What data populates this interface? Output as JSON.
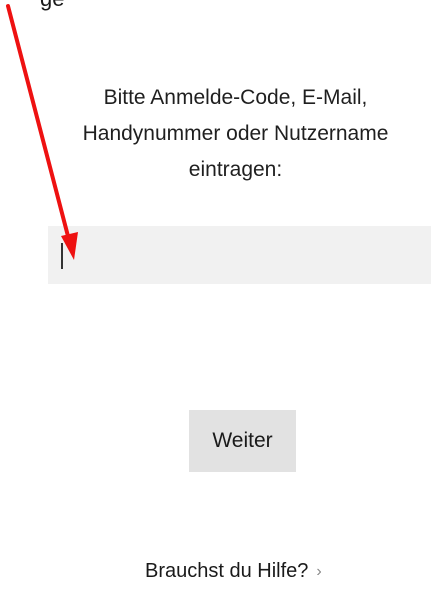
{
  "top_text": "ge",
  "prompt": {
    "line1": "Bitte Anmelde-Code, E-Mail,",
    "line2": "Handynummer oder Nutzername",
    "line3": "eintragen:"
  },
  "login_input": {
    "value": "",
    "placeholder": ""
  },
  "next_button_label": "Weiter",
  "help_link": {
    "label": "Brauchst du Hilfe?",
    "chevron": "›"
  },
  "annotation": {
    "icon": "arrow-icon",
    "color": "#ee1111"
  }
}
